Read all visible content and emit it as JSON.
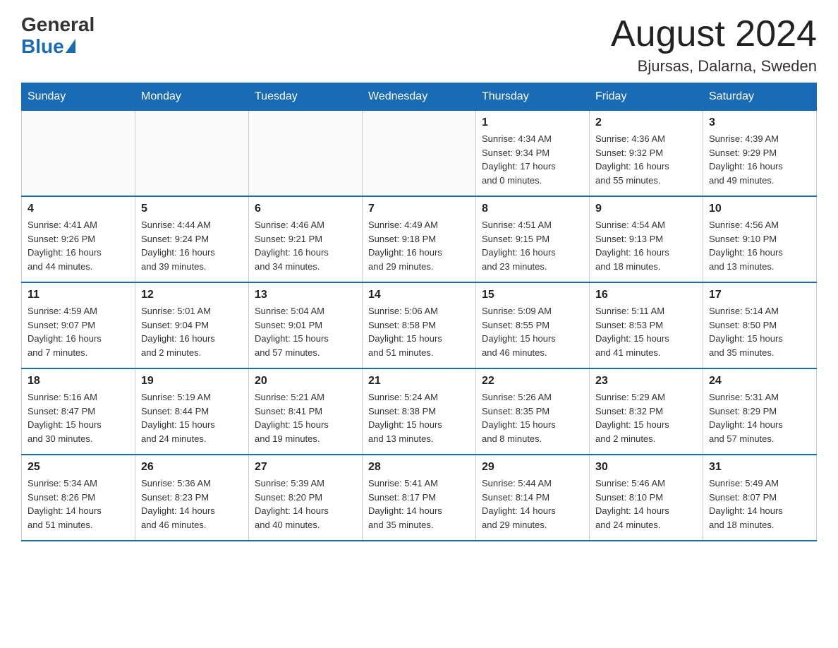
{
  "header": {
    "logo": {
      "general": "General",
      "blue": "Blue"
    },
    "title": "August 2024",
    "location": "Bjursas, Dalarna, Sweden"
  },
  "calendar": {
    "days_of_week": [
      "Sunday",
      "Monday",
      "Tuesday",
      "Wednesday",
      "Thursday",
      "Friday",
      "Saturday"
    ],
    "weeks": [
      [
        {
          "day": "",
          "info": ""
        },
        {
          "day": "",
          "info": ""
        },
        {
          "day": "",
          "info": ""
        },
        {
          "day": "",
          "info": ""
        },
        {
          "day": "1",
          "info": "Sunrise: 4:34 AM\nSunset: 9:34 PM\nDaylight: 17 hours\nand 0 minutes."
        },
        {
          "day": "2",
          "info": "Sunrise: 4:36 AM\nSunset: 9:32 PM\nDaylight: 16 hours\nand 55 minutes."
        },
        {
          "day": "3",
          "info": "Sunrise: 4:39 AM\nSunset: 9:29 PM\nDaylight: 16 hours\nand 49 minutes."
        }
      ],
      [
        {
          "day": "4",
          "info": "Sunrise: 4:41 AM\nSunset: 9:26 PM\nDaylight: 16 hours\nand 44 minutes."
        },
        {
          "day": "5",
          "info": "Sunrise: 4:44 AM\nSunset: 9:24 PM\nDaylight: 16 hours\nand 39 minutes."
        },
        {
          "day": "6",
          "info": "Sunrise: 4:46 AM\nSunset: 9:21 PM\nDaylight: 16 hours\nand 34 minutes."
        },
        {
          "day": "7",
          "info": "Sunrise: 4:49 AM\nSunset: 9:18 PM\nDaylight: 16 hours\nand 29 minutes."
        },
        {
          "day": "8",
          "info": "Sunrise: 4:51 AM\nSunset: 9:15 PM\nDaylight: 16 hours\nand 23 minutes."
        },
        {
          "day": "9",
          "info": "Sunrise: 4:54 AM\nSunset: 9:13 PM\nDaylight: 16 hours\nand 18 minutes."
        },
        {
          "day": "10",
          "info": "Sunrise: 4:56 AM\nSunset: 9:10 PM\nDaylight: 16 hours\nand 13 minutes."
        }
      ],
      [
        {
          "day": "11",
          "info": "Sunrise: 4:59 AM\nSunset: 9:07 PM\nDaylight: 16 hours\nand 7 minutes."
        },
        {
          "day": "12",
          "info": "Sunrise: 5:01 AM\nSunset: 9:04 PM\nDaylight: 16 hours\nand 2 minutes."
        },
        {
          "day": "13",
          "info": "Sunrise: 5:04 AM\nSunset: 9:01 PM\nDaylight: 15 hours\nand 57 minutes."
        },
        {
          "day": "14",
          "info": "Sunrise: 5:06 AM\nSunset: 8:58 PM\nDaylight: 15 hours\nand 51 minutes."
        },
        {
          "day": "15",
          "info": "Sunrise: 5:09 AM\nSunset: 8:55 PM\nDaylight: 15 hours\nand 46 minutes."
        },
        {
          "day": "16",
          "info": "Sunrise: 5:11 AM\nSunset: 8:53 PM\nDaylight: 15 hours\nand 41 minutes."
        },
        {
          "day": "17",
          "info": "Sunrise: 5:14 AM\nSunset: 8:50 PM\nDaylight: 15 hours\nand 35 minutes."
        }
      ],
      [
        {
          "day": "18",
          "info": "Sunrise: 5:16 AM\nSunset: 8:47 PM\nDaylight: 15 hours\nand 30 minutes."
        },
        {
          "day": "19",
          "info": "Sunrise: 5:19 AM\nSunset: 8:44 PM\nDaylight: 15 hours\nand 24 minutes."
        },
        {
          "day": "20",
          "info": "Sunrise: 5:21 AM\nSunset: 8:41 PM\nDaylight: 15 hours\nand 19 minutes."
        },
        {
          "day": "21",
          "info": "Sunrise: 5:24 AM\nSunset: 8:38 PM\nDaylight: 15 hours\nand 13 minutes."
        },
        {
          "day": "22",
          "info": "Sunrise: 5:26 AM\nSunset: 8:35 PM\nDaylight: 15 hours\nand 8 minutes."
        },
        {
          "day": "23",
          "info": "Sunrise: 5:29 AM\nSunset: 8:32 PM\nDaylight: 15 hours\nand 2 minutes."
        },
        {
          "day": "24",
          "info": "Sunrise: 5:31 AM\nSunset: 8:29 PM\nDaylight: 14 hours\nand 57 minutes."
        }
      ],
      [
        {
          "day": "25",
          "info": "Sunrise: 5:34 AM\nSunset: 8:26 PM\nDaylight: 14 hours\nand 51 minutes."
        },
        {
          "day": "26",
          "info": "Sunrise: 5:36 AM\nSunset: 8:23 PM\nDaylight: 14 hours\nand 46 minutes."
        },
        {
          "day": "27",
          "info": "Sunrise: 5:39 AM\nSunset: 8:20 PM\nDaylight: 14 hours\nand 40 minutes."
        },
        {
          "day": "28",
          "info": "Sunrise: 5:41 AM\nSunset: 8:17 PM\nDaylight: 14 hours\nand 35 minutes."
        },
        {
          "day": "29",
          "info": "Sunrise: 5:44 AM\nSunset: 8:14 PM\nDaylight: 14 hours\nand 29 minutes."
        },
        {
          "day": "30",
          "info": "Sunrise: 5:46 AM\nSunset: 8:10 PM\nDaylight: 14 hours\nand 24 minutes."
        },
        {
          "day": "31",
          "info": "Sunrise: 5:49 AM\nSunset: 8:07 PM\nDaylight: 14 hours\nand 18 minutes."
        }
      ]
    ]
  }
}
